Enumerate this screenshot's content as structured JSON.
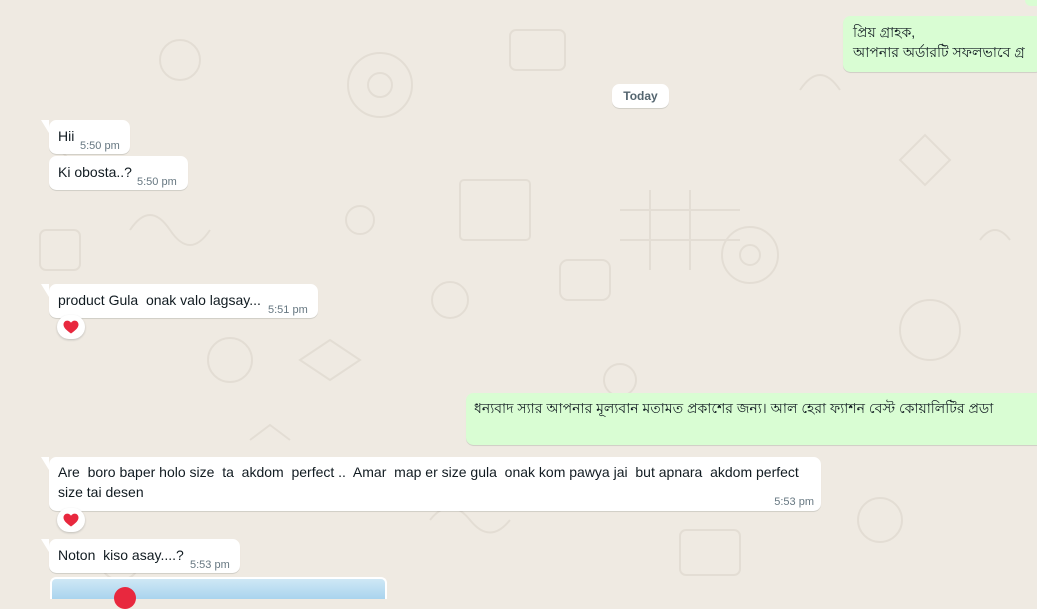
{
  "colors": {
    "background": "#efeae2",
    "incoming": "#ffffff",
    "outgoing": "#d9fdd3",
    "heart": "#e8283e"
  },
  "date_divider": "Today",
  "outgoing_top": {
    "line1": "প্রিয় গ্রাহক,",
    "line2": "আপনার অর্ডারটি সফলভাবে গ্র"
  },
  "messages": [
    {
      "text": "Hii",
      "time": "5:50 pm"
    },
    {
      "text": "Ki obosta..?",
      "time": "5:50 pm"
    },
    {
      "text": "product Gula  onak valo lagsay...",
      "time": "5:51 pm",
      "reaction": "heart-icon"
    },
    {
      "text": "Are  boro baper holo size  ta  akdom  perfect ..  Amar  map er size gula  onak kom pawya jai  but apnara  akdom perfect size tai desen",
      "time": "5:53 pm",
      "reaction": "heart-icon"
    },
    {
      "text": "Noton  kiso asay....?",
      "time": "5:53 pm"
    }
  ],
  "outgoing_reply": {
    "text": "ধন্যবাদ স্যার আপনার মূল্যবান মতামত প্রকাশের জন্য। আল হেরা ফ্যাশন বেস্ট কোয়ালিটির প্রডা"
  }
}
